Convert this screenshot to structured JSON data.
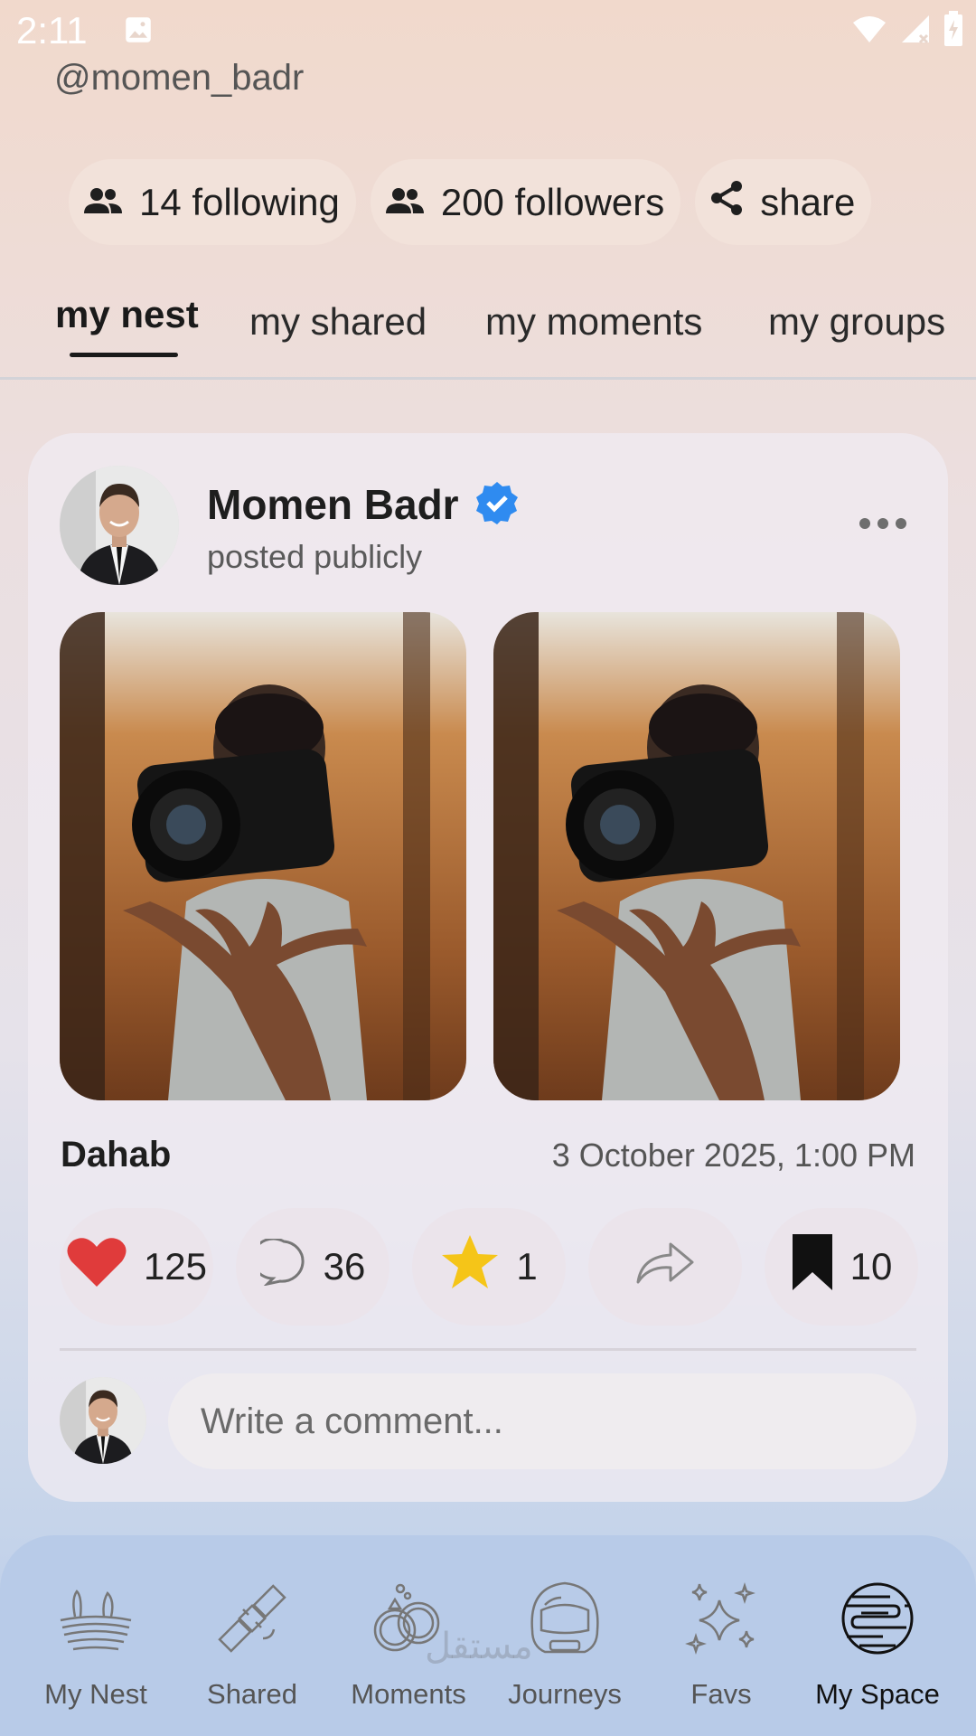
{
  "status_bar": {
    "time": "2:11"
  },
  "profile": {
    "handle": "@momen_badr"
  },
  "chips": [
    {
      "icon": "group-icon",
      "label": "14 following"
    },
    {
      "icon": "group-icon",
      "label": "200 followers"
    },
    {
      "icon": "share-icon",
      "label": "share"
    }
  ],
  "tabs": [
    {
      "label": "my nest",
      "active": true
    },
    {
      "label": "my shared"
    },
    {
      "label": "my moments"
    },
    {
      "label": "my groups"
    }
  ],
  "post": {
    "author": "Momen Badr",
    "visibility": "posted publicly",
    "location": "Dahab",
    "date": "3 October 2025, 1:00 PM",
    "actions": {
      "likes": "125",
      "comments": "36",
      "stars": "1",
      "bookmarks": "10"
    },
    "comment_placeholder": "Write a comment..."
  },
  "bottom_nav": [
    {
      "label": "My Nest",
      "icon": "nest-icon"
    },
    {
      "label": "Shared",
      "icon": "satellite-icon"
    },
    {
      "label": "Moments",
      "icon": "rings-icon"
    },
    {
      "label": "Journeys",
      "icon": "astronaut-helmet-icon"
    },
    {
      "label": "Favs",
      "icon": "sparkles-icon",
      "watermark": "مستقل"
    },
    {
      "label": "My Space",
      "icon": "planet-icon",
      "active": true
    }
  ],
  "colors": {
    "like": "#e03b3b",
    "star": "#f5c518",
    "verified": "#2f8bf0"
  }
}
